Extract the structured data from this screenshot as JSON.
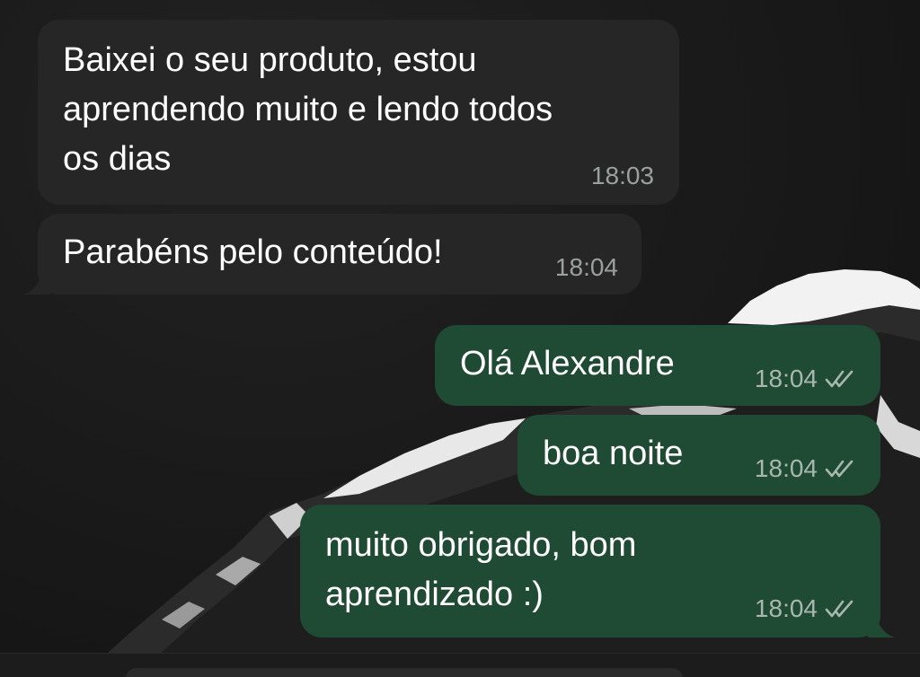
{
  "chat": {
    "messages": [
      {
        "direction": "incoming",
        "text": "Baixei o seu produto, estou\naprendendo muito e lendo todos\nos dias",
        "time": "18:03"
      },
      {
        "direction": "incoming",
        "text": "Parabéns pelo conteúdo!",
        "time": "18:04"
      },
      {
        "direction": "outgoing",
        "text": "Olá Alexandre",
        "time": "18:04",
        "status_icon": "double-check-icon"
      },
      {
        "direction": "outgoing",
        "text": "boa noite",
        "time": "18:04",
        "status_icon": "double-check-icon"
      },
      {
        "direction": "outgoing",
        "text": "muito obrigado, bom\naprendizado :)",
        "time": "18:04",
        "status_icon": "double-check-icon"
      }
    ]
  },
  "colors": {
    "incoming_bubble": "#262626",
    "outgoing_bubble": "#1f4a33",
    "background": "#161616"
  }
}
